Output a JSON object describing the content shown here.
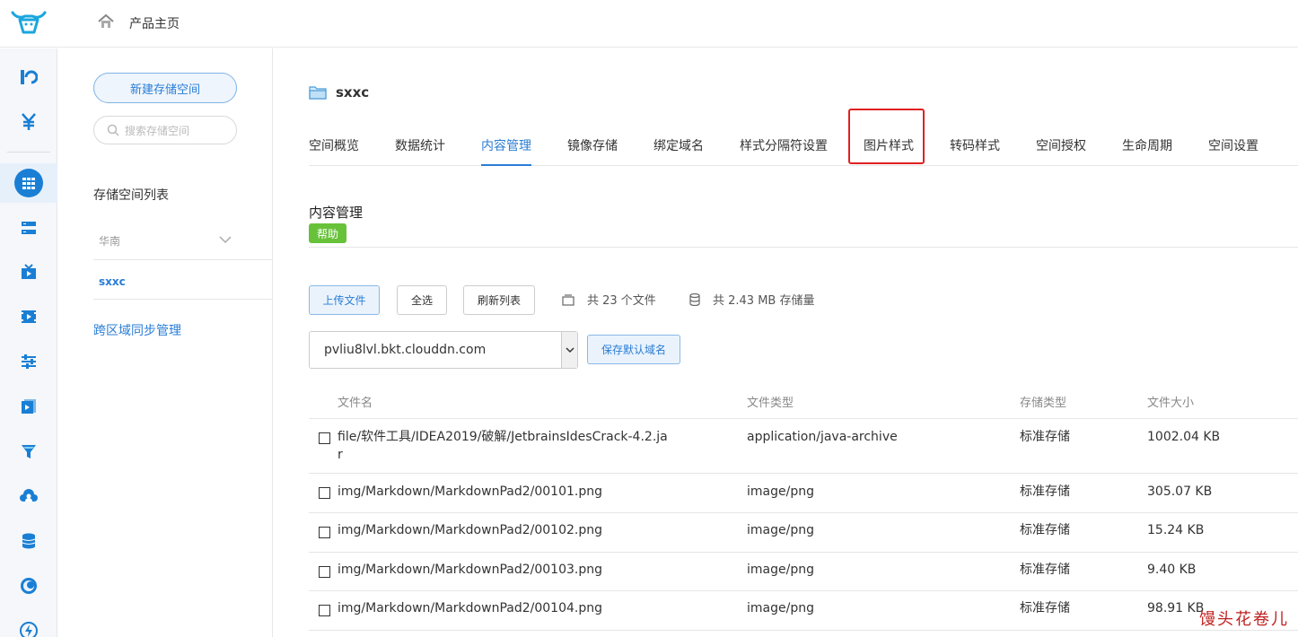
{
  "header": {
    "logo": "qiniu-bull-logo",
    "home_icon": "home-icon",
    "product_home": "产品主页"
  },
  "rail": {
    "items": [
      "kodo-icon",
      "yuan-icon",
      "storage-grid-icon",
      "server-icon",
      "tv-icon",
      "video-icon",
      "sliders-icon",
      "play-doc-icon",
      "funnel-icon",
      "cloud-user-icon",
      "database-icon",
      "moon-icon",
      "bolt-icon"
    ],
    "accent": "#2a7dd6"
  },
  "sidebar": {
    "new_bucket": "新建存储空间",
    "search_placeholder": "搜索存储空间",
    "list_title": "存储空间列表",
    "region": "华南",
    "bucket": "sxxc",
    "sync": "跨区域同步管理"
  },
  "main": {
    "bucket_name": "sxxc",
    "tabs": [
      "空间概览",
      "数据统计",
      "内容管理",
      "镜像存储",
      "绑定域名",
      "样式分隔符设置",
      "图片样式",
      "转码样式",
      "空间授权",
      "生命周期",
      "空间设置"
    ],
    "active_tab": "内容管理",
    "highlighted_tab": "图片样式",
    "section_title": "内容管理",
    "help": "帮助",
    "toolbar": {
      "upload": "上传文件",
      "select_all": "全选",
      "refresh": "刷新列表",
      "file_count": "共 23 个文件",
      "storage_used": "共 2.43 MB 存储量"
    },
    "domain": {
      "value": "pvliu8lvl.bkt.clouddn.com",
      "save_default": "保存默认域名"
    },
    "table": {
      "columns": [
        "文件名",
        "文件类型",
        "存储类型",
        "文件大小"
      ],
      "rows": [
        {
          "name_line1": "file/软件工具/IDEA2019/破解/JetbrainsIdesCrack-4.2.ja",
          "name_line2": "r",
          "type": "application/java-archive",
          "storage": "标准存储",
          "size": "1002.04 KB"
        },
        {
          "name_line1": "img/Markdown/MarkdownPad2/00101.png",
          "name_line2": "",
          "type": "image/png",
          "storage": "标准存储",
          "size": "305.07 KB"
        },
        {
          "name_line1": "img/Markdown/MarkdownPad2/00102.png",
          "name_line2": "",
          "type": "image/png",
          "storage": "标准存储",
          "size": "15.24 KB"
        },
        {
          "name_line1": "img/Markdown/MarkdownPad2/00103.png",
          "name_line2": "",
          "type": "image/png",
          "storage": "标准存储",
          "size": "9.40 KB"
        },
        {
          "name_line1": "img/Markdown/MarkdownPad2/00104.png",
          "name_line2": "",
          "type": "image/png",
          "storage": "标准存储",
          "size": "98.91 KB"
        }
      ]
    }
  },
  "watermark": "馒头花卷儿",
  "colors": {
    "primary": "#2a7dd6",
    "help_green": "#67c23a",
    "highlight_red": "#e02020"
  }
}
